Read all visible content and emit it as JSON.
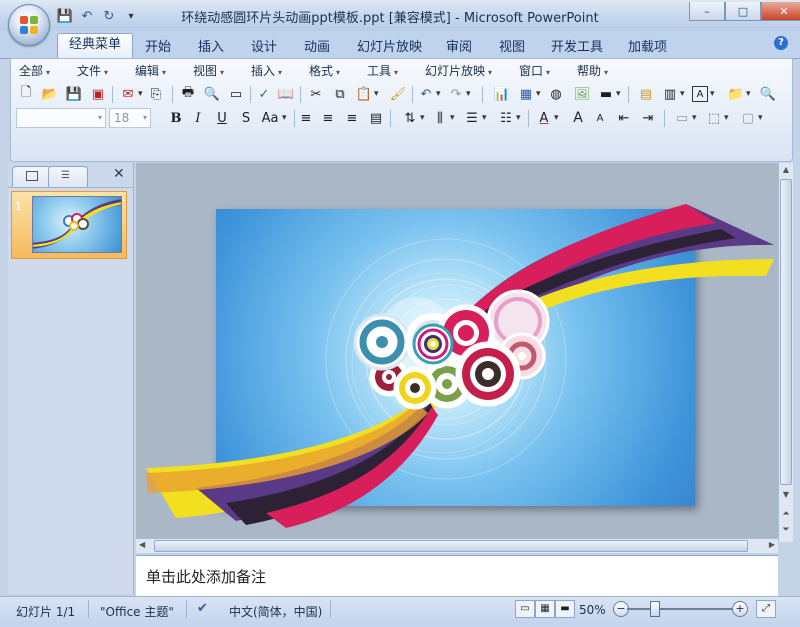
{
  "window": {
    "title": "环绕动感圆环片头动画ppt模板.ppt [兼容模式] - Microsoft PowerPoint",
    "controls": {
      "minimize": "–",
      "maximize": "□",
      "close": "✕"
    }
  },
  "quick_access": {
    "save": "💾",
    "undo": "↶",
    "redo": "↻",
    "customize": "▾"
  },
  "ribbon_tabs": [
    "经典菜单",
    "开始",
    "插入",
    "设计",
    "动画",
    "幻灯片放映",
    "审阅",
    "视图",
    "开发工具",
    "加载项"
  ],
  "classic_menu": [
    "全部",
    "文件",
    "编辑",
    "视图",
    "插入",
    "格式",
    "工具",
    "幻灯片放映",
    "窗口",
    "帮助"
  ],
  "toolbar": {
    "font_name": "",
    "font_size": "18",
    "bold": "B",
    "italic": "I",
    "underline": "U",
    "shadow": "S",
    "change_case": "Aa",
    "grow_font": "A",
    "shrink_font": "A"
  },
  "slide_panel": {
    "slide_number": "1"
  },
  "notes": {
    "placeholder": "单击此处添加备注"
  },
  "status": {
    "slide_info": "幻灯片 1/1",
    "theme": "\"Office 主题\"",
    "language": "中文(简体，中国)",
    "zoom": "50%",
    "zoom_out": "−",
    "zoom_in": "+"
  },
  "colors": {
    "stripe_purple": "#5a3a86",
    "stripe_yellow": "#f2e020",
    "stripe_red": "#d81e5b",
    "stripe_dark": "#2d2235",
    "slide_blue": "#3e94da"
  }
}
